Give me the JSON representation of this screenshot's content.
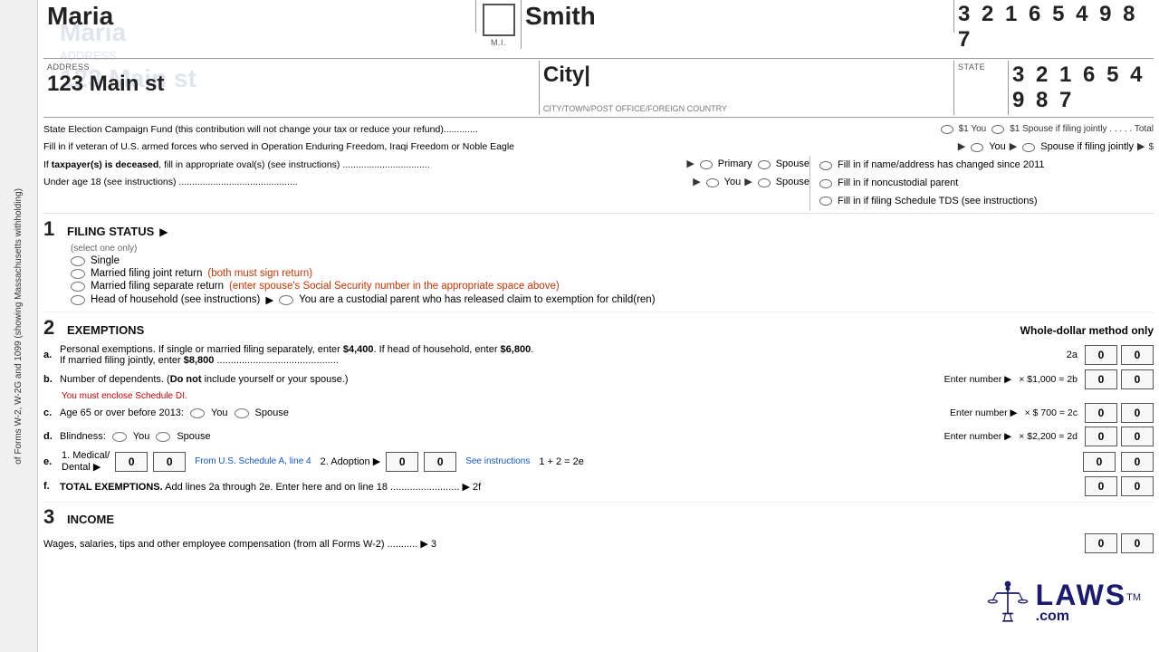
{
  "sidebar": {
    "text": "of Forms W-2, W-2G and 1099 (showing Massachusetts withholding)"
  },
  "header": {
    "first_name": "Maria",
    "mi_label": "M.I.",
    "last_name": "Smith",
    "address_label": "ADDRESS",
    "ssn": "3 2 1 6 5 4 9 8 7",
    "address": "123 Main st",
    "city": "City",
    "city_label": "CITY/TOWN/POST OFFICE/FOREIGN COUNTRY",
    "state_label": "STATE",
    "cursor": "|"
  },
  "campaign": {
    "line1": "State Election Campaign Fund (this contribution will not change your tax or reduce your refund)",
    "line1_dots": ".............",
    "line1_amount": "$1 You",
    "line1_spouse": "$1 Spouse if filing jointly",
    "line1_total": "Total",
    "line2": "Fill in if veteran of U.S. armed forces who served in Operation Enduring Freedom, Iraqi Freedom or Noble Eagle",
    "line2_you": "You",
    "line2_spouse": "Spouse",
    "line2_jointly": "if filing jointly",
    "line2_dollar": "$",
    "line3": "If taxpayer(s) is deceased, fill in appropriate oval(s) (see instructions)",
    "line3_primary": "Primary",
    "line3_spouse": "Spouse",
    "line4": "Under age 18 (see instructions)",
    "line4_you": "You",
    "line4_spouse": "Spouse",
    "line_changed": "Fill in if name/address has changed since 2011",
    "line_noncustodial": "Fill in if noncustodial parent",
    "line_schedule": "Fill in if filing Schedule TDS (see instructions)"
  },
  "section1": {
    "number": "1",
    "title": "FILING STATUS",
    "arrow": "▶",
    "select_note": "(select one only)",
    "options": [
      "Single",
      "Married filing joint return",
      "Married filing separate return",
      "Head of household (see instructions)"
    ],
    "notes": [
      "(both must sign return)",
      "(enter spouse's Social Security number in the appropriate space above)",
      "▶  You are a custodial parent who has released claim to exemption for child(ren)"
    ],
    "right_options": [
      "Fill in if name/address has changed since 2011",
      "Fill in if noncustodial parent",
      "Fill in if filing Schedule TDS (see instructions)"
    ]
  },
  "section2": {
    "number": "2",
    "title": "EXEMPTIONS",
    "whole_dollar": "Whole-dollar method only",
    "row_a_label": "a.",
    "row_a_text": "Personal exemptions. If single or married filing separately, enter $4,400. If head of household, enter $6,800.",
    "row_a_text2": "If married filing jointly, enter $8,800",
    "row_a_ref": "2a",
    "row_a_values": [
      "0",
      "0"
    ],
    "row_b_label": "b.",
    "row_b_text": "Number of dependents. (Do not include yourself or your spouse.)",
    "row_b_enter": "Enter number ▶",
    "row_b_multiply": "× $1,000 = 2b",
    "row_b_note": "You must enclose Schedule DI.",
    "row_b_values": [
      "0",
      "0"
    ],
    "row_c_label": "c.",
    "row_c_text": "Age 65 or over before 2013:",
    "row_c_you": "You",
    "row_c_spouse": "Spouse",
    "row_c_enter": "Enter number ▶",
    "row_c_multiply": "× $  700 = 2c",
    "row_c_values": [
      "0",
      "0"
    ],
    "row_d_label": "d.",
    "row_d_text": "Blindness:",
    "row_d_you": "You",
    "row_d_spouse": "Spouse",
    "row_d_enter": "Enter number ▶",
    "row_d_multiply": "× $2,200 = 2d",
    "row_d_values": [
      "0",
      "0"
    ],
    "row_e_label": "e.",
    "row_e_text1": "1. Medical/",
    "row_e_text1b": "Dental ▶",
    "row_e_box1_val": "0",
    "row_e_box2_val": "0",
    "row_e_text2": "2. Adoption ▶",
    "row_e_box3_val": "0",
    "row_e_box4_val": "0",
    "row_e_text3": "1 + 2 = 2e",
    "row_e_schedule": "From U.S. Schedule A, line 4",
    "row_e_see": "See instructions",
    "row_e_values": [
      "0",
      "0"
    ],
    "row_f_label": "f.",
    "row_f_text": "TOTAL EXEMPTIONS. Add lines 2a through 2e. Enter here and on line 18",
    "row_f_dots": "......................",
    "row_f_ref": "▶ 2f",
    "row_f_values": [
      "0",
      "0"
    ]
  },
  "section3": {
    "number": "3",
    "title": "INCOME",
    "row_wages_text": "Wages, salaries, tips and other employee compensation (from all Forms W-2)",
    "row_wages_dots": "...........",
    "row_wages_arrow": "▶ 3",
    "row_wages_values": [
      "0",
      "0"
    ]
  },
  "watermark": {
    "company": "LAWS",
    "tm": "TM",
    "dot_com": ".com"
  },
  "you_label": "You",
  "primary_label": "Primary",
  "spouse_label": "Spouse"
}
